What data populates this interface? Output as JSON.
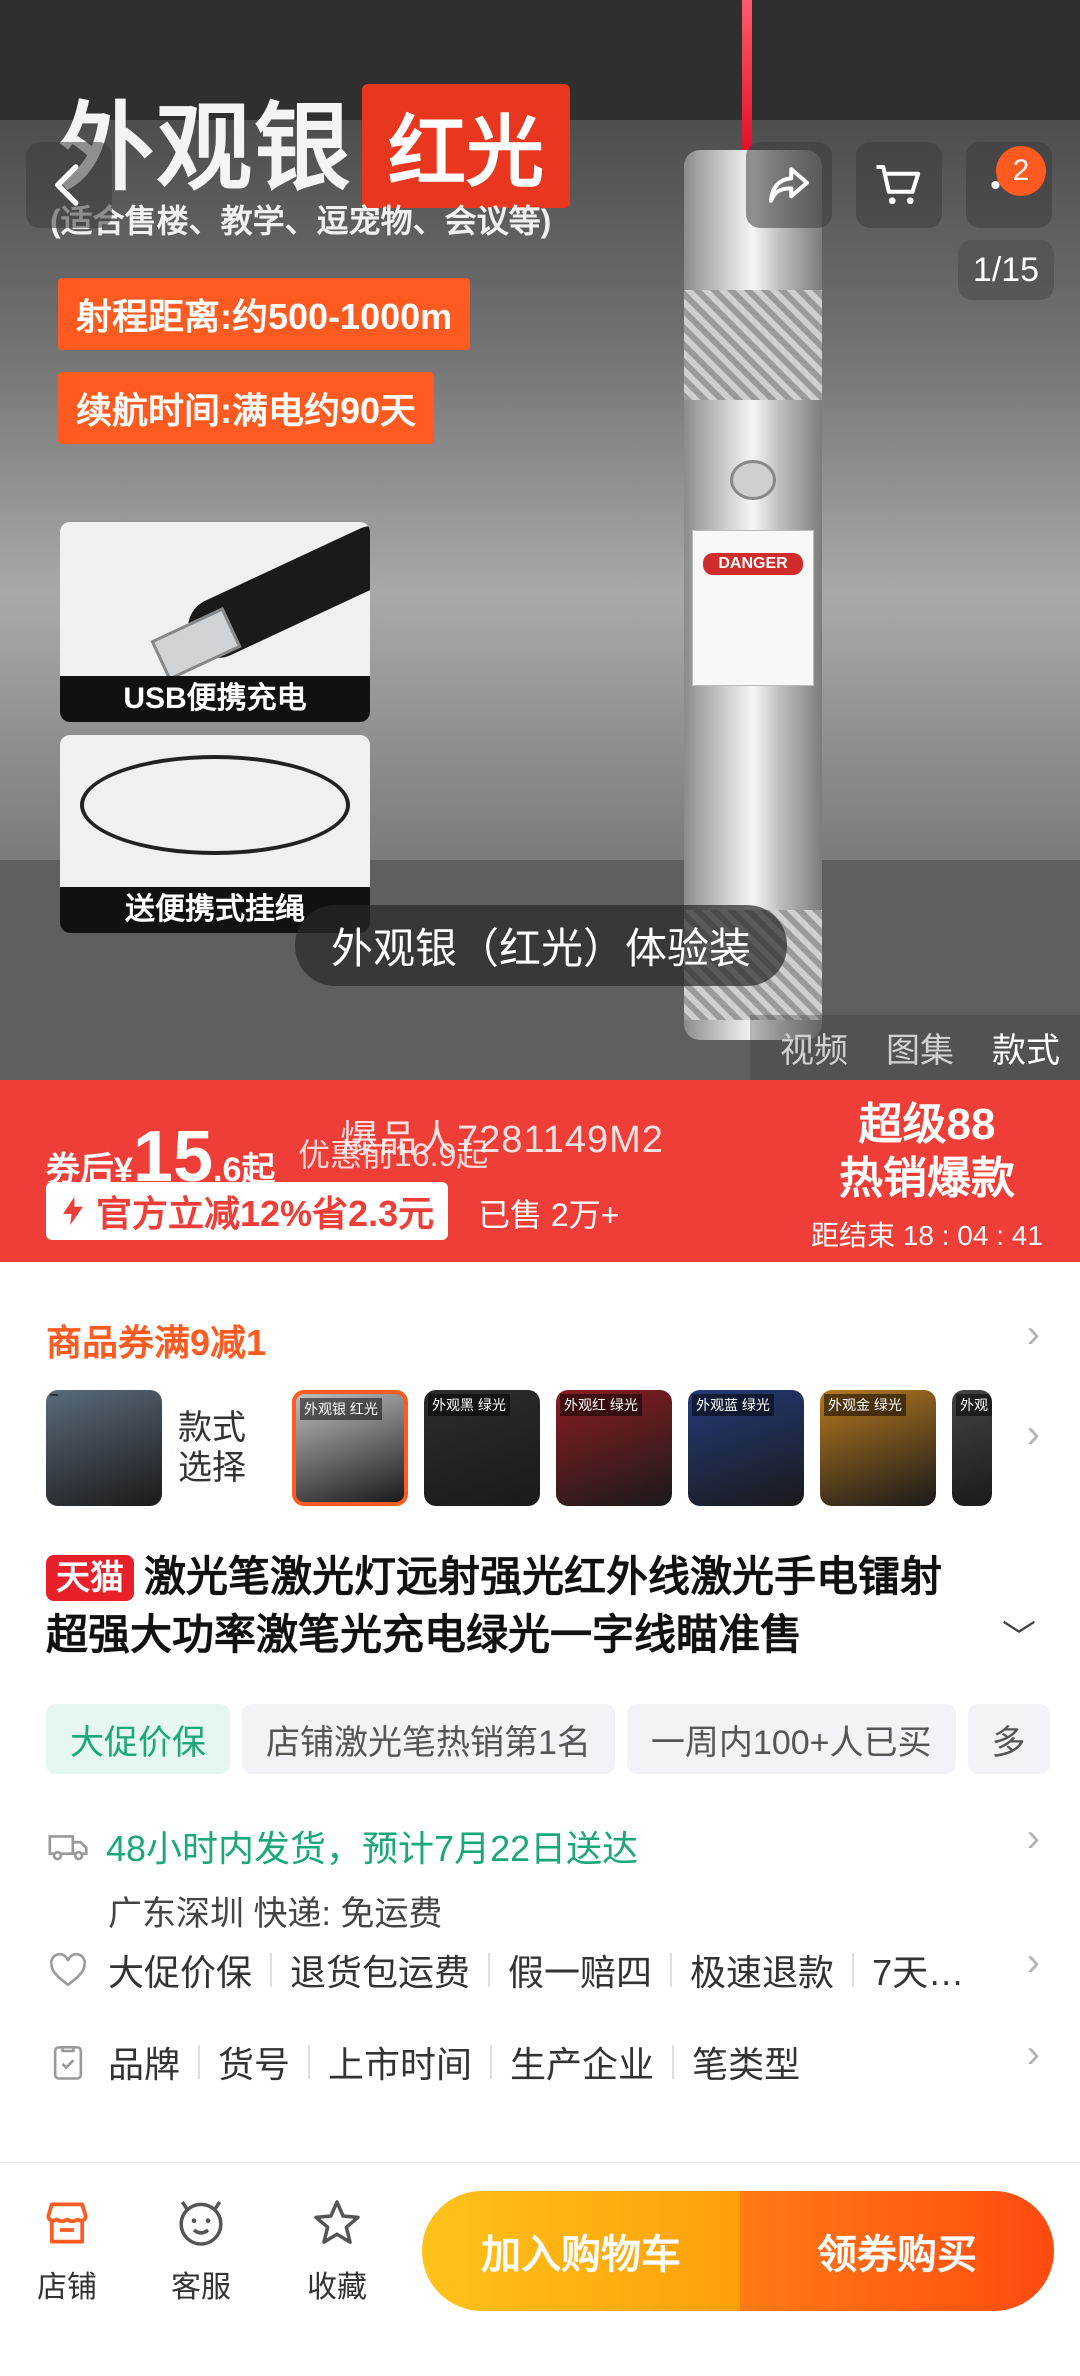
{
  "hero": {
    "title": "外观银",
    "title_tag": "红光",
    "subtitle": "(适合售楼、教学、逗宠物、会议等)",
    "spec_range": "射程距离:约500-1000m",
    "spec_battery": "续航时间:满电约90天",
    "usb_label": "USB便携充电",
    "rope_label": "送便携式挂绳",
    "variant_caption": "外观银（红光）体验装",
    "page_indicator": "1/15",
    "cart_badge": "2",
    "media_tabs": [
      "视频",
      "图集",
      "款式"
    ],
    "danger_text": "DANGER"
  },
  "price_bar": {
    "after_coupon_label": "券后",
    "currency": "¥",
    "price_int": "15",
    "price_dec": ".6",
    "price_suffix": "起",
    "pre_price": "优惠前16.9起",
    "watermark": "爆品人7281149M2",
    "official_discount": "官方立减12%省2.3元",
    "sold": "已售 2万+",
    "promo_title_1": "超级88",
    "promo_title_2": "热销爆款",
    "countdown": "距结束 18 : 04 : 41"
  },
  "coupon": {
    "text": "商品券满9减1"
  },
  "variants": {
    "label": "款式选择",
    "thumbs": [
      {
        "tag": "",
        "color": "#5a6b7a"
      },
      {
        "tag": "外观银 红光",
        "color": "#bfbfbf"
      },
      {
        "tag": "外观黑 绿光",
        "color": "#2c2c2c"
      },
      {
        "tag": "外观红 绿光",
        "color": "#8a1d22"
      },
      {
        "tag": "外观蓝 绿光",
        "color": "#243a78"
      },
      {
        "tag": "外观金 绿光",
        "color": "#b5781f"
      },
      {
        "tag": "外观",
        "color": "#444444"
      }
    ]
  },
  "product": {
    "store_badge": "天猫",
    "title": "激光笔激光灯远射强光红外线激光手电镭射超强大功率激笔光充电绿光一字线瞄准售"
  },
  "tags": [
    "大促价保",
    "店铺激光笔热销第1名",
    "一周内100+人已买",
    "多"
  ],
  "shipping": {
    "line1": "48小时内发货，预计7月22日送达",
    "line2": "广东深圳  快递: 免运费"
  },
  "services": [
    "大促价保",
    "退货包运费",
    "假一赔四",
    "极速退款",
    "7天…"
  ],
  "params": [
    "品牌",
    "货号",
    "上市时间",
    "生产企业",
    "笔类型"
  ],
  "bottom_bar": {
    "store": "店铺",
    "service": "客服",
    "favorite": "收藏",
    "add_cart": "加入购物车",
    "buy": "领券购买"
  },
  "colors": {
    "accent": "#ff5a1f",
    "price_red": "#ef3d38",
    "green": "#1aa77a"
  }
}
